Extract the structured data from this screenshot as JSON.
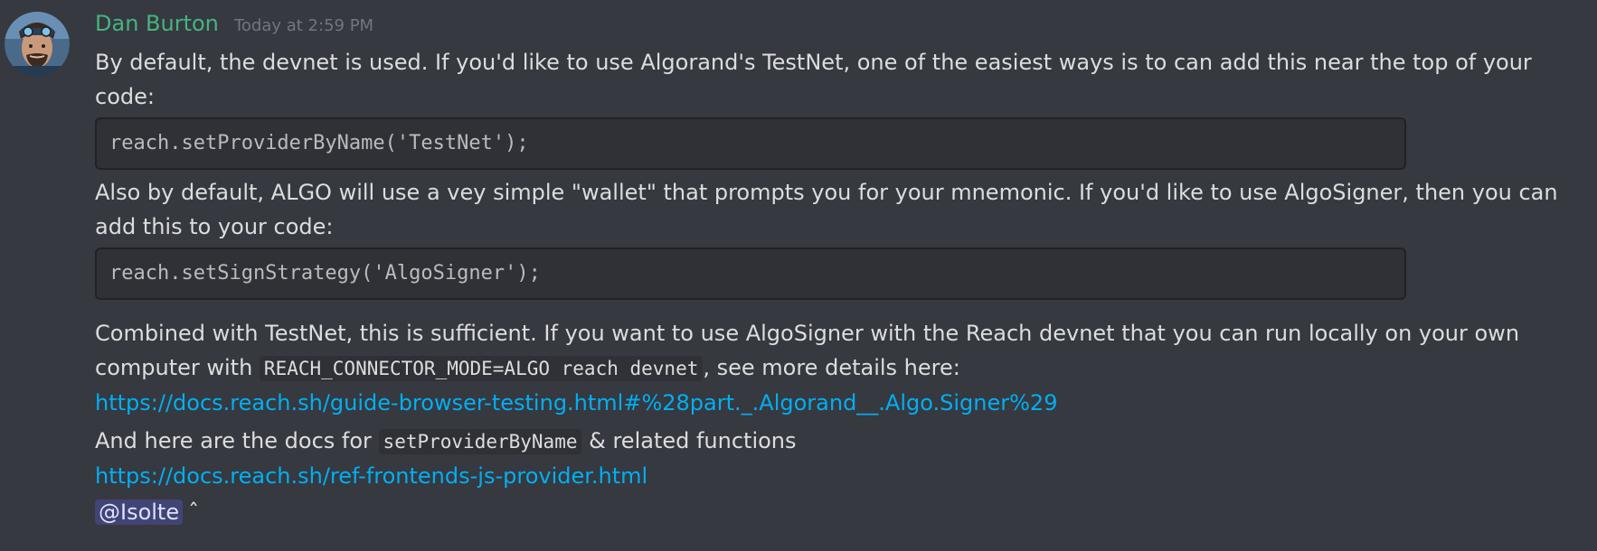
{
  "message": {
    "author": "Dan Burton",
    "timestamp": "Today at 2:59 PM",
    "author_color": "#43b581",
    "avatar_icon": "avatar-illustration",
    "para1": "By default, the devnet is used. If you'd like to use Algorand's TestNet, one of the easiest ways is to can add this near the top of your code:",
    "code1": "reach.setProviderByName('TestNet');",
    "para2": "Also by default, ALGO will use a vey simple \"wallet\" that prompts you for your mnemonic. If you'd like to use AlgoSigner, then you can add this to your code:",
    "code2": "reach.setSignStrategy('AlgoSigner');",
    "para3_text1": "Combined with TestNet, this is sufficient. If you want to use AlgoSigner with the Reach devnet that you can run locally on your own computer with ",
    "para3_code": "REACH_CONNECTOR_MODE=ALGO reach devnet",
    "para3_text2": ", see more details here:",
    "link1": "https://docs.reach.sh/guide-browser-testing.html#%28part._.Algorand__.Algo.Signer%29",
    "para4_text1": "And here are the docs for ",
    "para4_code": "setProviderByName",
    "para4_text2": " & related functions",
    "link2": "https://docs.reach.sh/ref-frontends-js-provider.html",
    "mention": "@Isolte",
    "caret": "ˆ"
  },
  "colors": {
    "background": "#36393f",
    "text": "#dcddde",
    "link": "#00aff4",
    "timestamp": "#72767d",
    "code_bg": "#2f3136"
  }
}
